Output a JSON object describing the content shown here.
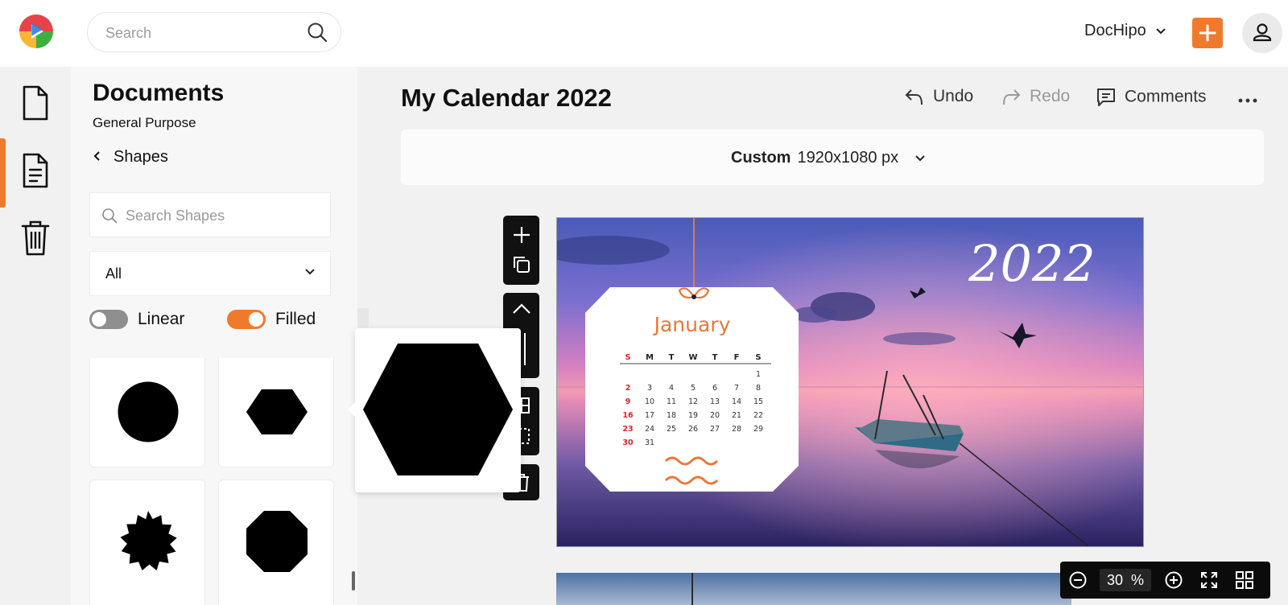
{
  "app": {
    "logo_name": "dochipo-logo",
    "search_placeholder": "Search",
    "account_name": "DocHipo",
    "accent_color": "#f07a2c"
  },
  "sidebar": {
    "title": "Documents",
    "subtitle": "General Purpose",
    "back_label": "Shapes",
    "search_placeholder": "Search Shapes",
    "filter_value": "All",
    "toggle_linear_label": "Linear",
    "toggle_linear_on": false,
    "toggle_filled_label": "Filled",
    "toggle_filled_on": true,
    "shapes": [
      "circle-shape",
      "hexagon-shape",
      "starburst-shape",
      "octagon-shape"
    ]
  },
  "editor": {
    "doc_title": "My Calendar 2022",
    "undo_label": "Undo",
    "redo_label": "Redo",
    "comments_label": "Comments",
    "size_preset": "Custom",
    "size_value": "1920x1080 px",
    "zoom_value": "30",
    "zoom_unit": "%"
  },
  "calendar": {
    "year": "2022",
    "month": "January",
    "weekdays": [
      "S",
      "M",
      "T",
      "W",
      "T",
      "F",
      "S"
    ],
    "weeks": [
      [
        "",
        "",
        "",
        "",
        "",
        "",
        "1"
      ],
      [
        "2",
        "3",
        "4",
        "5",
        "6",
        "7",
        "8"
      ],
      [
        "9",
        "10",
        "11",
        "12",
        "13",
        "14",
        "15"
      ],
      [
        "16",
        "17",
        "18",
        "19",
        "20",
        "21",
        "22"
      ],
      [
        "23",
        "24",
        "25",
        "26",
        "27",
        "28",
        "29"
      ],
      [
        "30",
        "31",
        "",
        "",
        "",
        "",
        ""
      ]
    ]
  }
}
